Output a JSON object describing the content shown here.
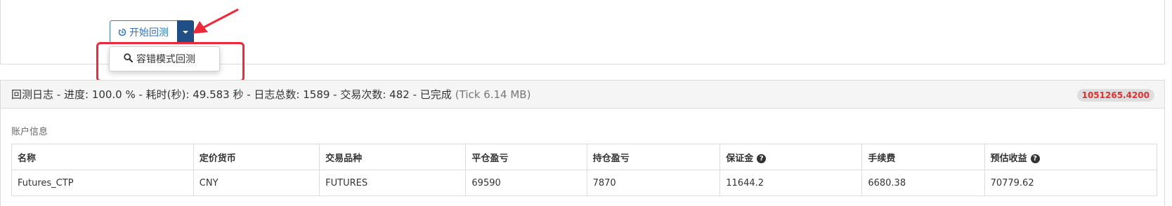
{
  "toolbar": {
    "start_backtest_label": "开始回测",
    "dropdown_items": [
      {
        "label": "容错模式回测",
        "icon": "search-icon"
      }
    ]
  },
  "log": {
    "title": "回测日志 - 进度: 100.0 % - 耗时(秒): 49.583 秒 - 日志总数: 1589 - 交易次数: 482 - 已完成",
    "tick_info": "(Tick 6.14 MB)",
    "badge_value": "1051265.4200"
  },
  "account": {
    "section_label": "账户信息",
    "columns": [
      "名称",
      "定价货币",
      "交易品种",
      "平仓盈亏",
      "持仓盈亏",
      "保证金",
      "手续费",
      "预估收益"
    ],
    "rows": [
      [
        "Futures_CTP",
        "CNY",
        "FUTURES",
        "69590",
        "7870",
        "11644.2",
        "6680.38",
        "70779.62"
      ]
    ]
  },
  "colors": {
    "primary_blue": "#2f74c0",
    "caret_button": "#1f4f85",
    "annotation_red": "#ee2a3a",
    "badge_text": "#e03131"
  }
}
